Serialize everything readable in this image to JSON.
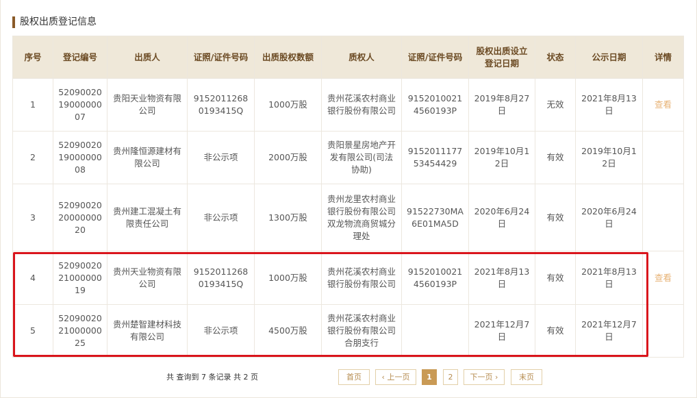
{
  "section": {
    "title": "股权出质登记信息"
  },
  "table": {
    "headers": [
      "序号",
      "登记编号",
      "出质人",
      "证照/证件号码",
      "出质股权数额",
      "质权人",
      "证照/证件号码",
      "股权出质设立登记日期",
      "状态",
      "公示日期",
      "详情"
    ],
    "rows": [
      {
        "no": "1",
        "reg_no": "520900201900000007",
        "pledgor": "贵阳天业物资有限公司",
        "pledgor_id": "91520112680193415Q",
        "amount": "1000万股",
        "pledgee": "贵州花溪农村商业银行股份有限公司",
        "pledgee_id": "91520100214560193P",
        "reg_date": "2019年8月27日",
        "status": "无效",
        "pub_date": "2021年8月13日",
        "detail": "查看"
      },
      {
        "no": "2",
        "reg_no": "520900201900000008",
        "pledgor": "贵州隆恒源建材有限公司",
        "pledgor_id": "非公示项",
        "amount": "2000万股",
        "pledgee": "贵阳景星房地产开发有限公司(司法协助)",
        "pledgee_id": "915201117753454429",
        "reg_date": "2019年10月12日",
        "status": "有效",
        "pub_date": "2019年10月12日",
        "detail": ""
      },
      {
        "no": "3",
        "reg_no": "520900202000000020",
        "pledgor": "贵州建工混凝土有限责任公司",
        "pledgor_id": "非公示项",
        "amount": "1300万股",
        "pledgee": "贵州龙里农村商业银行股份有限公司双龙物流商贸城分理处",
        "pledgee_id": "91522730MA6E01MA5D",
        "reg_date": "2020年6月24日",
        "status": "有效",
        "pub_date": "2020年6月24日",
        "detail": ""
      },
      {
        "no": "4",
        "reg_no": "520900202100000019",
        "pledgor": "贵州天业物资有限公司",
        "pledgor_id": "91520112680193415Q",
        "amount": "1000万股",
        "pledgee": "贵州花溪农村商业银行股份有限公司",
        "pledgee_id": "91520100214560193P",
        "reg_date": "2021年8月13日",
        "status": "有效",
        "pub_date": "2021年8月13日",
        "detail": "查看"
      },
      {
        "no": "5",
        "reg_no": "520900202100000025",
        "pledgor": "贵州楚智建材科技有限公司",
        "pledgor_id": "非公示项",
        "amount": "4500万股",
        "pledgee": "贵州花溪农村商业银行股份有限公司合朋支行",
        "pledgee_id": "",
        "reg_date": "2021年12月7日",
        "status": "有效",
        "pub_date": "2021年12月7日",
        "detail": ""
      }
    ]
  },
  "pagination": {
    "summary": "共 查询到 7 条记录 共 2 页",
    "first": "首页",
    "prev": "‹ 上一页",
    "pages": [
      "1",
      "2"
    ],
    "current": "1",
    "next": "下一页 ›",
    "last": "末页"
  },
  "colors": {
    "accent": "#8a5a28",
    "header_bg": "#efe8d9",
    "link": "#e7b274",
    "highlight": "#d9141b"
  }
}
